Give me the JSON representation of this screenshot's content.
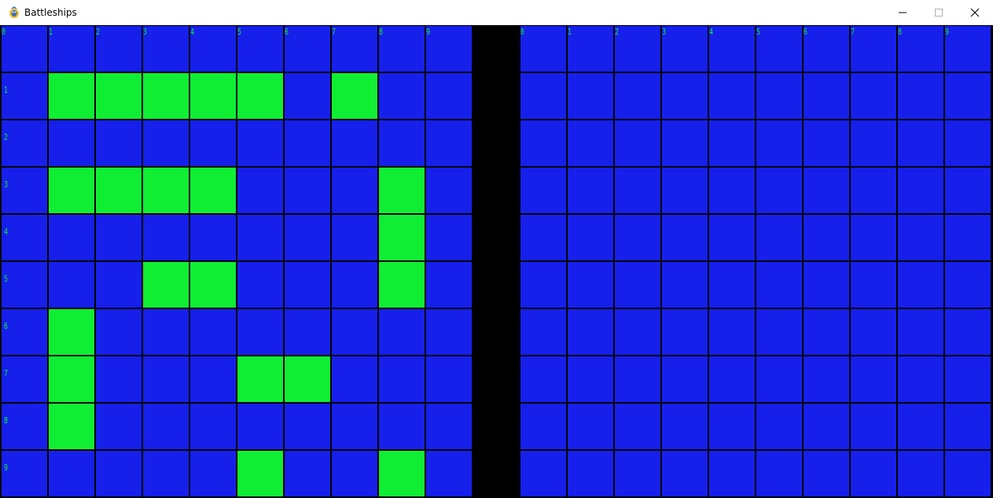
{
  "window": {
    "title": "Battleships",
    "icon": "pygame-snake-icon"
  },
  "colors": {
    "water": "#1620ea",
    "ship": "#10ee34",
    "grid_line": "#000000",
    "label": "#10ee34"
  },
  "player_board": {
    "column_labels": [
      "0",
      "1",
      "2",
      "3",
      "4",
      "5",
      "6",
      "7",
      "8",
      "9"
    ],
    "row_labels": [
      "0",
      "1",
      "2",
      "3",
      "4",
      "5",
      "6",
      "7",
      "8",
      "9"
    ],
    "ships": [
      [
        1,
        1
      ],
      [
        1,
        2
      ],
      [
        1,
        3
      ],
      [
        1,
        4
      ],
      [
        1,
        5
      ],
      [
        1,
        7
      ],
      [
        3,
        1
      ],
      [
        3,
        2
      ],
      [
        3,
        3
      ],
      [
        3,
        4
      ],
      [
        3,
        8
      ],
      [
        4,
        8
      ],
      [
        5,
        3
      ],
      [
        5,
        4
      ],
      [
        5,
        8
      ],
      [
        6,
        1
      ],
      [
        7,
        1
      ],
      [
        7,
        5
      ],
      [
        7,
        6
      ],
      [
        8,
        1
      ],
      [
        9,
        5
      ],
      [
        9,
        8
      ]
    ]
  },
  "enemy_board": {
    "column_labels": [
      "0",
      "1",
      "2",
      "3",
      "4",
      "5",
      "6",
      "7",
      "8",
      "9"
    ],
    "ships": []
  }
}
